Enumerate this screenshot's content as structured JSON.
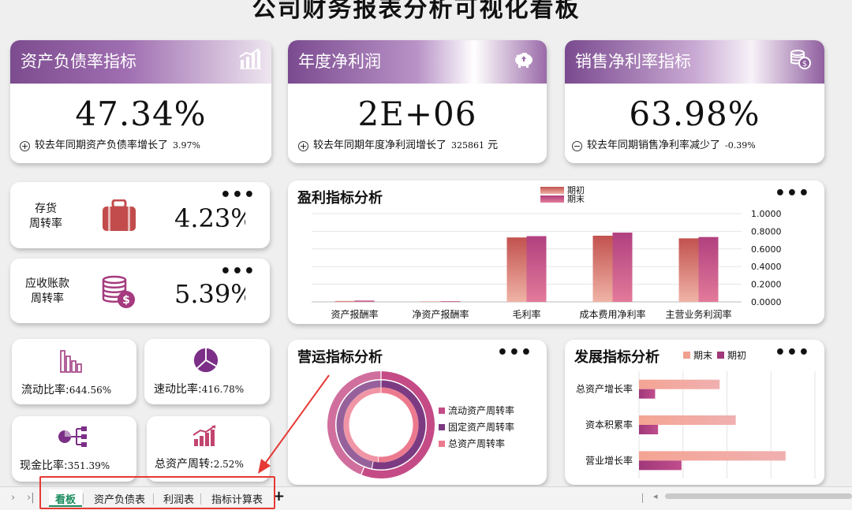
{
  "title": "公司财务报表分析可视化看板",
  "kpis": [
    {
      "title": "资产负债率指标",
      "value": "47.34%",
      "note_sign": "⊕",
      "note": "较去年同期资产负债率增长了",
      "note_value": "3.97%",
      "note_unit": "",
      "icon": "bar-chart-up-icon"
    },
    {
      "title": "年度净利润",
      "value": "2E+06",
      "note_sign": "⊕",
      "note": "较去年同期年度净利润增长了",
      "note_value": "325861",
      "note_unit": "元",
      "icon": "piggy-bank-icon"
    },
    {
      "title": "销售净利率指标",
      "value": "63.98%",
      "note_sign": "⊖",
      "note": "较去年同期销售净利率减少了",
      "note_value": "-0.39%",
      "note_unit": "",
      "icon": "coins-icon"
    }
  ],
  "turnover": [
    {
      "label_line1": "存货",
      "label_line2": "周转率",
      "value": "4.23%",
      "icon": "suitcase-icon"
    },
    {
      "label_line1": "应收账款",
      "label_line2": "周转率",
      "value": "5.39%",
      "icon": "money-stack-icon"
    }
  ],
  "ratios": [
    {
      "label": "流动比率:",
      "value": "644.56%",
      "icon": "bar-outline-icon"
    },
    {
      "label": "速动比率:",
      "value": "416.78%",
      "icon": "pie-icon"
    },
    {
      "label": "现金比率:",
      "value": "351.39%",
      "icon": "network-icon"
    },
    {
      "label": "总资产周转:",
      "value": "2.52%",
      "icon": "growth-bars-icon"
    }
  ],
  "menu_dots": "•••",
  "profit_section": {
    "title": "盈利指标分析"
  },
  "operation_section": {
    "title": "营运指标分析"
  },
  "growth_section": {
    "title": "发展指标分析"
  },
  "chart_data": [
    {
      "type": "bar",
      "title": "盈利指标分析",
      "categories": [
        "资产报酬率",
        "净资产报酬率",
        "毛利率",
        "成本费用净利率",
        "主营业务利润率"
      ],
      "series": [
        {
          "name": "期初",
          "values": [
            0.01,
            0.005,
            0.73,
            0.75,
            0.72
          ]
        },
        {
          "name": "期末",
          "values": [
            0.015,
            0.008,
            0.745,
            0.785,
            0.735
          ]
        }
      ],
      "ylim": [
        0,
        1
      ],
      "yticks": [
        "1.0000",
        "0.8000",
        "0.6000",
        "0.4000",
        "0.2000",
        "0.0000"
      ],
      "legend": "top",
      "colors": [
        "#c65a6a",
        "#b04a86"
      ]
    },
    {
      "type": "pie",
      "title": "营运指标分析",
      "series": [
        {
          "name": "流动资产周转率",
          "values": [
            5.39,
            4.23
          ],
          "color": "#c44b86"
        },
        {
          "name": "固定资产周转率",
          "values": [
            4.0,
            3.5
          ],
          "color": "#7c3a82"
        },
        {
          "name": "总资产周转率",
          "values": [
            2.52,
            2.4
          ],
          "color": "#ec7a8e"
        }
      ],
      "legend": "right"
    },
    {
      "type": "bar",
      "title": "发展指标分析",
      "orientation": "horizontal",
      "categories": [
        "总资产增长率",
        "资本积累率",
        "营业增长率"
      ],
      "series": [
        {
          "name": "期末",
          "values": [
            0.55,
            0.66,
            1.0
          ]
        },
        {
          "name": "期初",
          "values": [
            0.11,
            0.13,
            0.29
          ]
        }
      ],
      "xlim": [
        0,
        1.2
      ],
      "legend": "top",
      "colors": [
        "#f0a090",
        "#a0387a"
      ]
    }
  ],
  "sheet_tabs": [
    "看板",
    "资产负债表",
    "利润表",
    "指标计算表"
  ],
  "active_tab": "看板",
  "add_tab": "+",
  "nav_prev": "›",
  "nav_last": "›|",
  "scroll_left": "◂"
}
